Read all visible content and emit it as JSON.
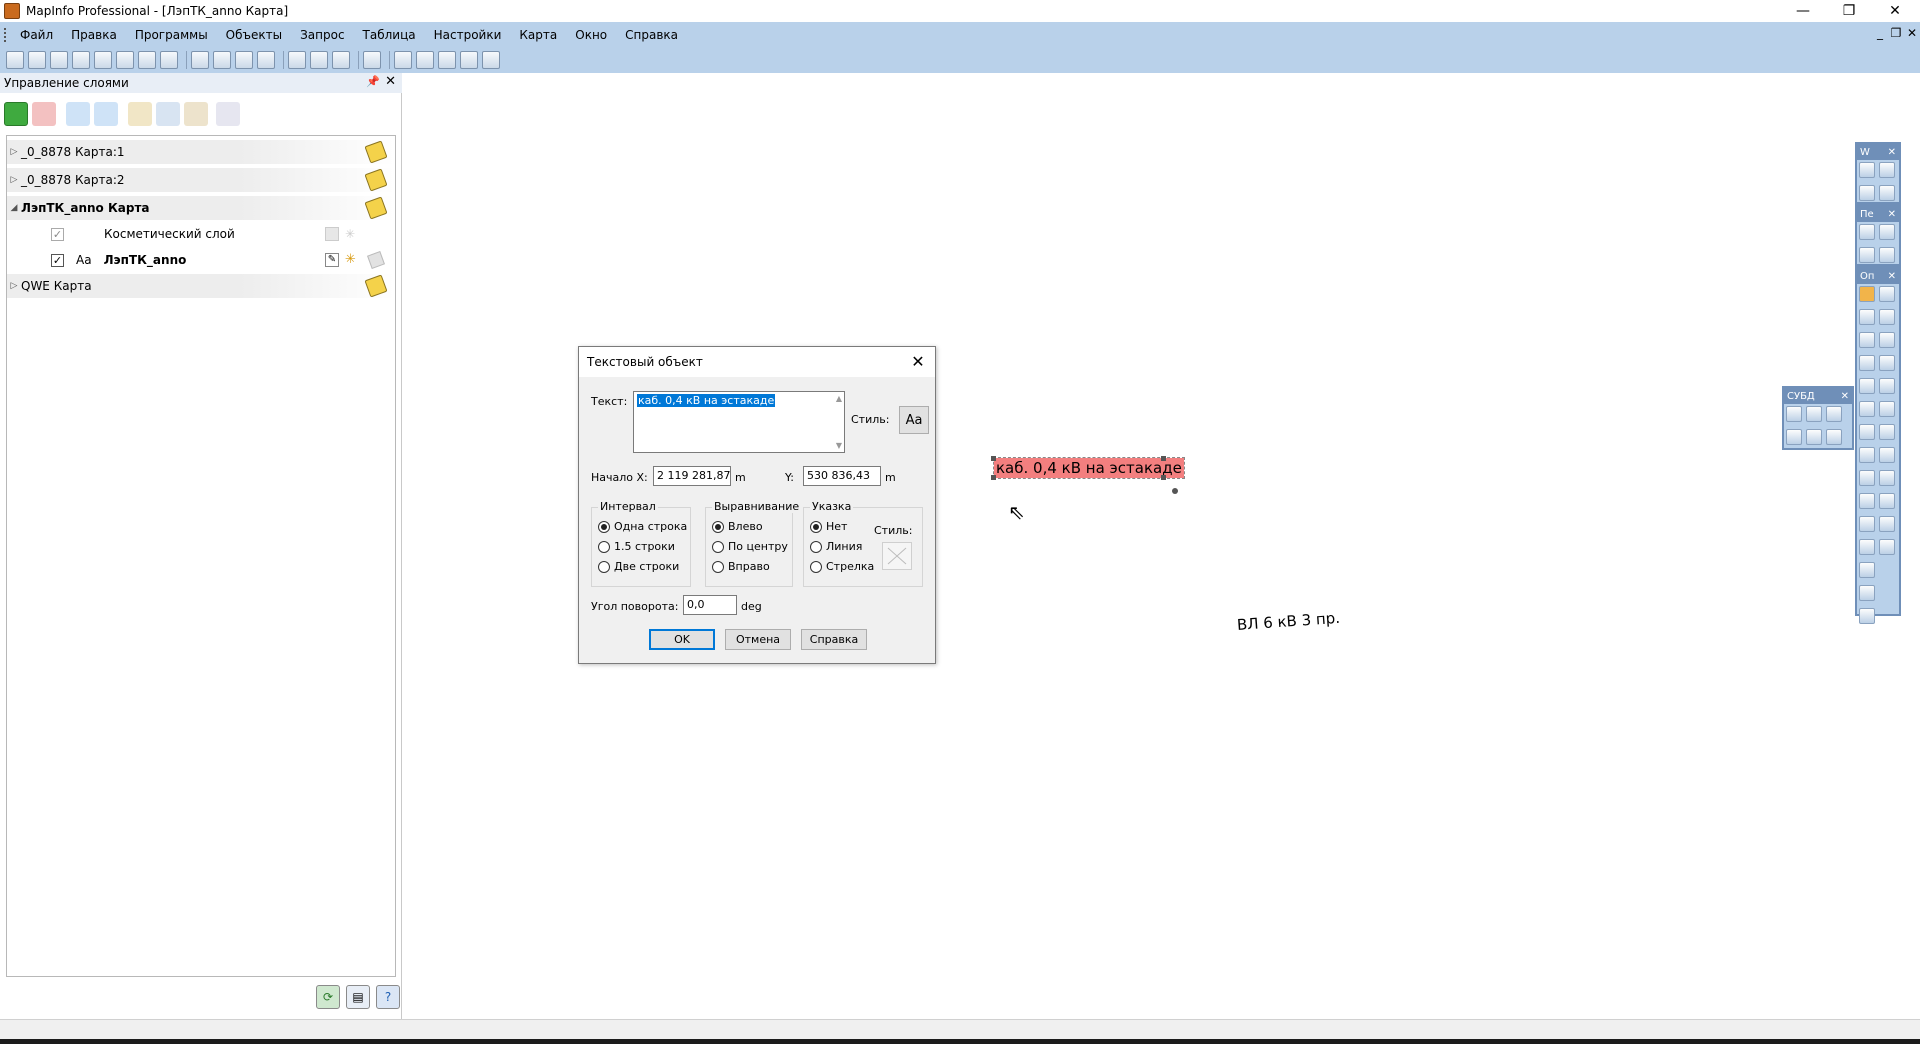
{
  "window": {
    "title": "MapInfo Professional - [ЛэпТК_anno Карта]",
    "minimize": "—",
    "restore": "❐",
    "close": "✕",
    "mdi_minimize": "_",
    "mdi_restore": "❐",
    "mdi_close": "✕"
  },
  "menu": [
    "Файл",
    "Правка",
    "Программы",
    "Объекты",
    "Запрос",
    "Таблица",
    "Настройки",
    "Карта",
    "Окно",
    "Справка"
  ],
  "layer_panel": {
    "title": "Управление слоями",
    "pin": "📌",
    "close": "✕",
    "rows": [
      {
        "label": "_0_8878 Карта:1",
        "expander": "▷"
      },
      {
        "label": "_0_8878 Карта:2",
        "expander": "▷"
      },
      {
        "label": "ЛэпТК_anno Карта",
        "expander": "◢"
      },
      {
        "label": "Косметический слой"
      },
      {
        "label": "ЛэпТК_anno",
        "type_label": "Aa"
      },
      {
        "label": "QWE Карта",
        "expander": "▷"
      }
    ],
    "check_mark": "✓"
  },
  "map": {
    "selected_label": "каб. 0,4 кВ на эстакаде",
    "other_label": "ВЛ 6 кВ 3 пр.",
    "highlight_color": "#f37f7f"
  },
  "dialog": {
    "title": "Текстовый объект",
    "close": "✕",
    "text_label": "Текст:",
    "text_value": "каб. 0,4 кВ на эстакаде",
    "style_label": "Стиль:",
    "style_button": "Aa",
    "start_x_label": "Начало X:",
    "x_value": "2 119 281,87",
    "x_unit": "m",
    "y_label": "Y:",
    "y_value": "530 836,43",
    "y_unit": "m",
    "interval": {
      "title": "Интервал",
      "options": [
        "Одна строка",
        "1.5 строки",
        "Две строки"
      ],
      "selected": 0
    },
    "alignment": {
      "title": "Выравнивание",
      "options": [
        "Влево",
        "По центру",
        "Вправо"
      ],
      "selected": 0
    },
    "pointer": {
      "title": "Указка",
      "options": [
        "Нет",
        "Линия",
        "Стрелка"
      ],
      "selected": 0,
      "style_label": "Стиль:"
    },
    "rotation_label": "Угол поворота:",
    "rotation_value": "0,0",
    "rotation_unit": "deg",
    "ok": "OK",
    "cancel": "Отмена",
    "help": "Справка"
  },
  "floating_panels": {
    "p1": "W",
    "p2": "Пе",
    "p3": "Оп",
    "dbms": "СУБД",
    "close": "✕"
  }
}
